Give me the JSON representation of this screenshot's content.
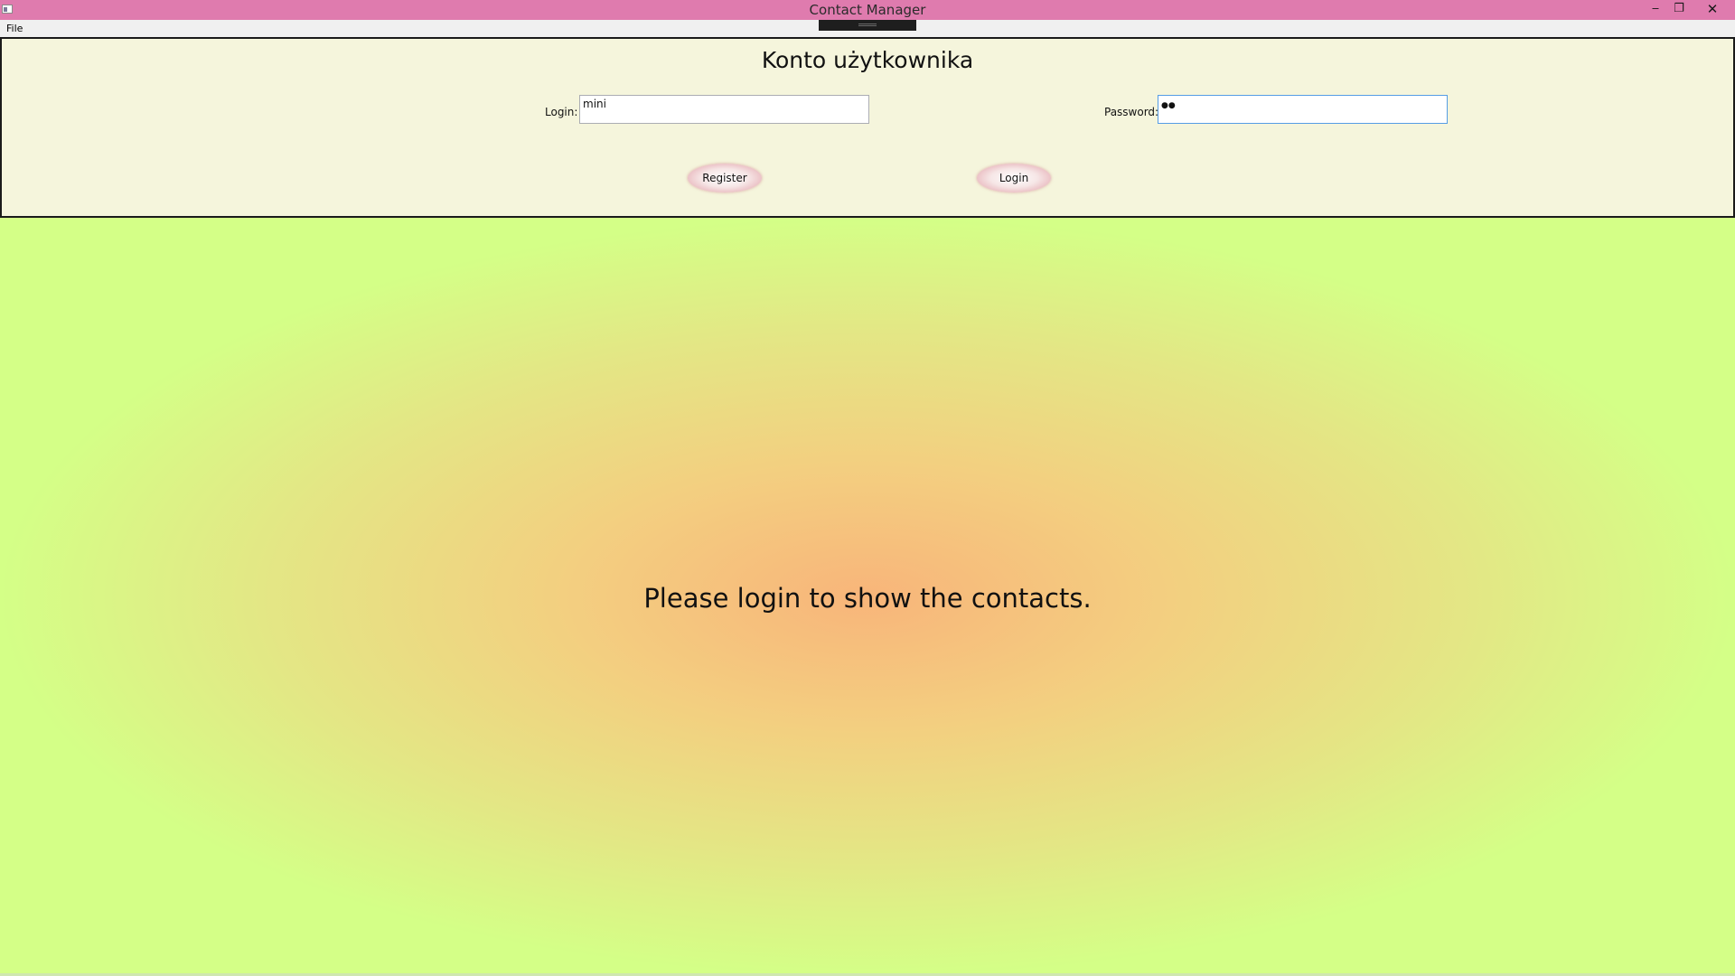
{
  "window": {
    "title": "Contact Manager",
    "minimize_glyph": "‒",
    "maximize_glyph": "❐",
    "close_glyph": "✕"
  },
  "menu": {
    "file_label": "File"
  },
  "login_panel": {
    "title": "Konto użytkownika",
    "login_label": "Login:",
    "login_value": "mini",
    "password_label": "Password:",
    "password_masked": "●●",
    "register_label": "Register",
    "login_button_label": "Login"
  },
  "main": {
    "message": "Please login to show the contacts."
  },
  "colors": {
    "titlebar": "#df7bae",
    "panel_background": "#f5f5dc",
    "gradient_center": "#f8b57a",
    "gradient_edge": "#d4ff87"
  },
  "icons": {
    "app": "app-window-icon",
    "minimize": "minimize-icon",
    "maximize": "restore-icon",
    "close": "close-icon"
  }
}
